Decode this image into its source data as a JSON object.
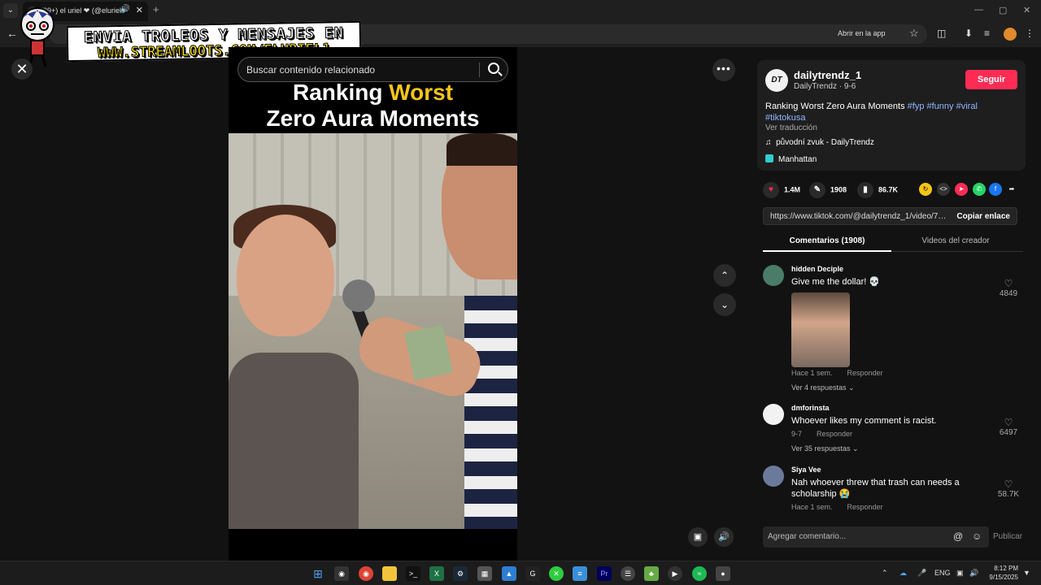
{
  "browser": {
    "tab_title": "(99+) el uriel ❤ (@eluriel0",
    "open_app": "Abrir en la app",
    "new_tab": "+",
    "win_min": "—",
    "win_max": "▢",
    "win_close": "✕"
  },
  "overlay": {
    "line1": "ENVIA TROLEOS Y MENSAJES EN",
    "line2": "WWW.STREAMLOOTS.COM/ELURIEL1"
  },
  "video": {
    "search_placeholder": "Buscar contenido relacionado",
    "title_a": "Ranking ",
    "title_b": "Worst",
    "title_c": "Zero Aura Moments"
  },
  "post": {
    "avatar_text": "DT",
    "username": "dailytrendz_1",
    "subline": "DailyTrendz · 9-6",
    "follow": "Seguir",
    "description": "Ranking Worst Zero Aura Moments ",
    "tags": [
      "#fyp",
      "#funny",
      "#viral",
      "#tiktokusa"
    ],
    "translate": "Ver traducción",
    "music": "původní zvuk - DailyTrendz",
    "location": "Manhattan"
  },
  "stats": {
    "likes": "1.4M",
    "comments": "1908",
    "saves": "86.7K"
  },
  "link": {
    "url": "https://www.tiktok.com/@dailytrendz_1/video/75...",
    "copy": "Copiar enlace"
  },
  "tabs": {
    "comments": "Comentarios (1908)",
    "creator": "Videos del creador"
  },
  "comments": [
    {
      "name": "hidden Deciple",
      "text": "Give me the dollar! 💀",
      "time": "Hace 1 sem.",
      "reply": "Responder",
      "more": "Ver 4 respuestas ⌄",
      "likes": "4849",
      "avatar_color": "#4a7c6a"
    },
    {
      "name": "dmforinsta",
      "text": "Whoever likes my comment is racist.",
      "time": "9-7",
      "reply": "Responder",
      "more": "Ver 35 respuestas ⌄",
      "likes": "6497",
      "avatar_color": "#f2f2f2"
    },
    {
      "name": "Siya Vee",
      "text": "Nah whoever threw that trash can needs a scholarship 😭",
      "time": "Hace 1 sem.",
      "reply": "Responder",
      "likes": "58.7K",
      "avatar_color": "#6b7a9a"
    }
  ],
  "composer": {
    "placeholder": "Agregar comentario...",
    "publish": "Publicar"
  },
  "taskbar": {
    "lang": "ENG",
    "time": "8:12 PM",
    "date": "9/15/2025"
  },
  "colors": {
    "accent": "#fe2c55",
    "hashtag": "#8fb7ff",
    "title_highlight": "#f5c518"
  }
}
